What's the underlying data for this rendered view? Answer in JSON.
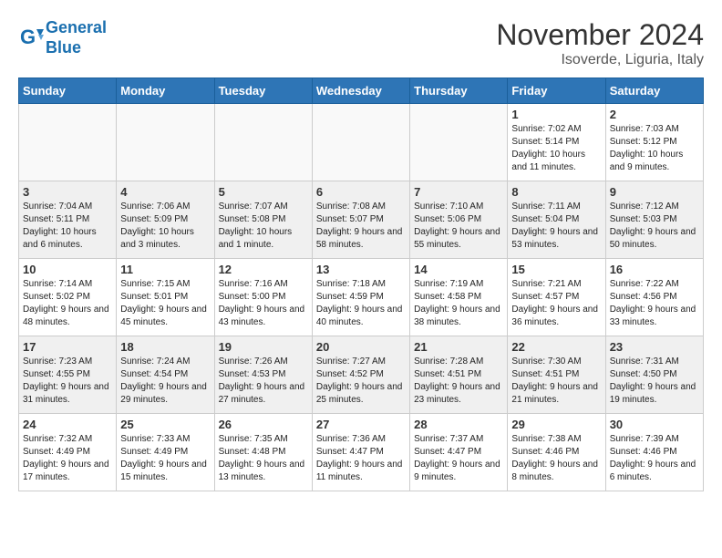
{
  "header": {
    "logo_line1": "General",
    "logo_line2": "Blue",
    "month_title": "November 2024",
    "location": "Isoverde, Liguria, Italy"
  },
  "days_of_week": [
    "Sunday",
    "Monday",
    "Tuesday",
    "Wednesday",
    "Thursday",
    "Friday",
    "Saturday"
  ],
  "weeks": [
    [
      {
        "day": "",
        "info": ""
      },
      {
        "day": "",
        "info": ""
      },
      {
        "day": "",
        "info": ""
      },
      {
        "day": "",
        "info": ""
      },
      {
        "day": "",
        "info": ""
      },
      {
        "day": "1",
        "info": "Sunrise: 7:02 AM\nSunset: 5:14 PM\nDaylight: 10 hours and 11 minutes."
      },
      {
        "day": "2",
        "info": "Sunrise: 7:03 AM\nSunset: 5:12 PM\nDaylight: 10 hours and 9 minutes."
      }
    ],
    [
      {
        "day": "3",
        "info": "Sunrise: 7:04 AM\nSunset: 5:11 PM\nDaylight: 10 hours and 6 minutes."
      },
      {
        "day": "4",
        "info": "Sunrise: 7:06 AM\nSunset: 5:09 PM\nDaylight: 10 hours and 3 minutes."
      },
      {
        "day": "5",
        "info": "Sunrise: 7:07 AM\nSunset: 5:08 PM\nDaylight: 10 hours and 1 minute."
      },
      {
        "day": "6",
        "info": "Sunrise: 7:08 AM\nSunset: 5:07 PM\nDaylight: 9 hours and 58 minutes."
      },
      {
        "day": "7",
        "info": "Sunrise: 7:10 AM\nSunset: 5:06 PM\nDaylight: 9 hours and 55 minutes."
      },
      {
        "day": "8",
        "info": "Sunrise: 7:11 AM\nSunset: 5:04 PM\nDaylight: 9 hours and 53 minutes."
      },
      {
        "day": "9",
        "info": "Sunrise: 7:12 AM\nSunset: 5:03 PM\nDaylight: 9 hours and 50 minutes."
      }
    ],
    [
      {
        "day": "10",
        "info": "Sunrise: 7:14 AM\nSunset: 5:02 PM\nDaylight: 9 hours and 48 minutes."
      },
      {
        "day": "11",
        "info": "Sunrise: 7:15 AM\nSunset: 5:01 PM\nDaylight: 9 hours and 45 minutes."
      },
      {
        "day": "12",
        "info": "Sunrise: 7:16 AM\nSunset: 5:00 PM\nDaylight: 9 hours and 43 minutes."
      },
      {
        "day": "13",
        "info": "Sunrise: 7:18 AM\nSunset: 4:59 PM\nDaylight: 9 hours and 40 minutes."
      },
      {
        "day": "14",
        "info": "Sunrise: 7:19 AM\nSunset: 4:58 PM\nDaylight: 9 hours and 38 minutes."
      },
      {
        "day": "15",
        "info": "Sunrise: 7:21 AM\nSunset: 4:57 PM\nDaylight: 9 hours and 36 minutes."
      },
      {
        "day": "16",
        "info": "Sunrise: 7:22 AM\nSunset: 4:56 PM\nDaylight: 9 hours and 33 minutes."
      }
    ],
    [
      {
        "day": "17",
        "info": "Sunrise: 7:23 AM\nSunset: 4:55 PM\nDaylight: 9 hours and 31 minutes."
      },
      {
        "day": "18",
        "info": "Sunrise: 7:24 AM\nSunset: 4:54 PM\nDaylight: 9 hours and 29 minutes."
      },
      {
        "day": "19",
        "info": "Sunrise: 7:26 AM\nSunset: 4:53 PM\nDaylight: 9 hours and 27 minutes."
      },
      {
        "day": "20",
        "info": "Sunrise: 7:27 AM\nSunset: 4:52 PM\nDaylight: 9 hours and 25 minutes."
      },
      {
        "day": "21",
        "info": "Sunrise: 7:28 AM\nSunset: 4:51 PM\nDaylight: 9 hours and 23 minutes."
      },
      {
        "day": "22",
        "info": "Sunrise: 7:30 AM\nSunset: 4:51 PM\nDaylight: 9 hours and 21 minutes."
      },
      {
        "day": "23",
        "info": "Sunrise: 7:31 AM\nSunset: 4:50 PM\nDaylight: 9 hours and 19 minutes."
      }
    ],
    [
      {
        "day": "24",
        "info": "Sunrise: 7:32 AM\nSunset: 4:49 PM\nDaylight: 9 hours and 17 minutes."
      },
      {
        "day": "25",
        "info": "Sunrise: 7:33 AM\nSunset: 4:49 PM\nDaylight: 9 hours and 15 minutes."
      },
      {
        "day": "26",
        "info": "Sunrise: 7:35 AM\nSunset: 4:48 PM\nDaylight: 9 hours and 13 minutes."
      },
      {
        "day": "27",
        "info": "Sunrise: 7:36 AM\nSunset: 4:47 PM\nDaylight: 9 hours and 11 minutes."
      },
      {
        "day": "28",
        "info": "Sunrise: 7:37 AM\nSunset: 4:47 PM\nDaylight: 9 hours and 9 minutes."
      },
      {
        "day": "29",
        "info": "Sunrise: 7:38 AM\nSunset: 4:46 PM\nDaylight: 9 hours and 8 minutes."
      },
      {
        "day": "30",
        "info": "Sunrise: 7:39 AM\nSunset: 4:46 PM\nDaylight: 9 hours and 6 minutes."
      }
    ]
  ]
}
